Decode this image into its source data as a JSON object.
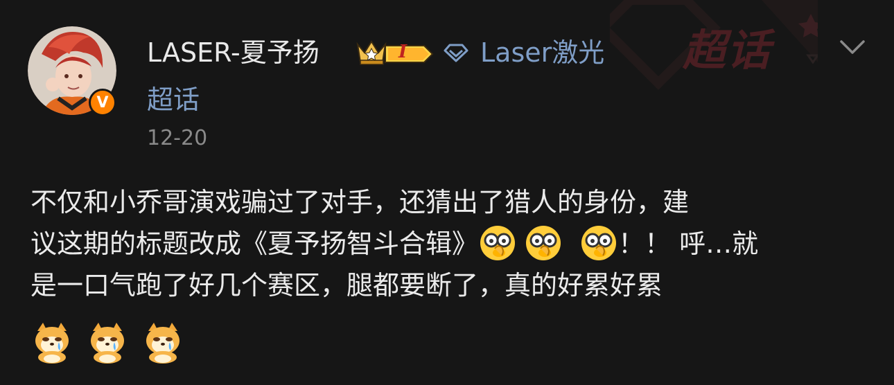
{
  "post": {
    "username": "LASER-夏予扬",
    "verified_badge": "V",
    "level_badge": "I",
    "topic_name": "Laser激光",
    "topic_suffix": "超话",
    "timestamp": "12-20",
    "watermark": "超话",
    "content_lines": [
      "不仅和小乔哥演戏骗过了对手，还猜出了猎人的身份，建",
      "议这期的标题改成《夏予扬智斗合辑》",
      "！！ 呼…就",
      "是一口气跑了好几个赛区，腿都要断了，真的好累好累"
    ],
    "emojis_inline": [
      "smart-face-emoji",
      "smart-face-emoji",
      "smart-face-emoji"
    ],
    "emojis_bottom": [
      "crying-doge-emoji",
      "crying-doge-emoji",
      "crying-doge-emoji"
    ]
  },
  "colors": {
    "background": "#161616",
    "text": "#ebebeb",
    "link": "#7f9ec7",
    "timestamp": "#8a8a8a",
    "verified": "#ff8200",
    "watermark": "#4a1e22"
  },
  "icons": {
    "more": "chevron-down-icon",
    "topic": "diamond-icon",
    "crown": "crown-badge-icon"
  }
}
